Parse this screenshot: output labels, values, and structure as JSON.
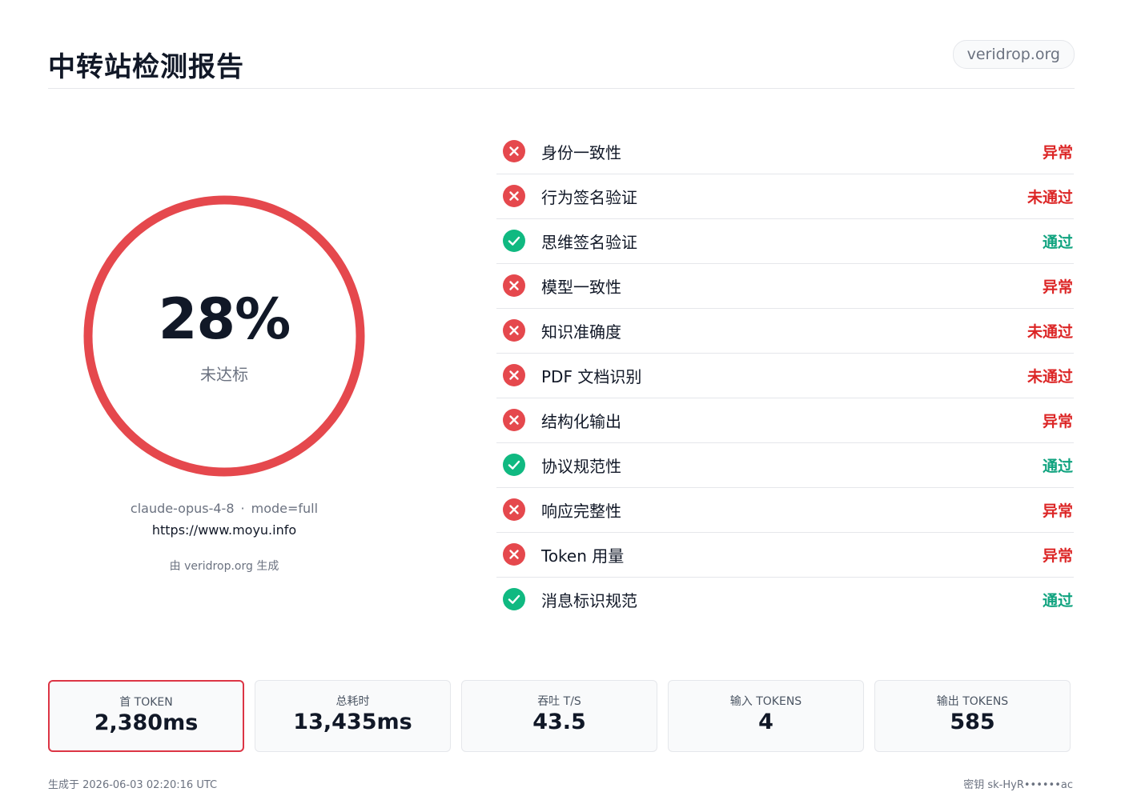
{
  "header": {
    "title": "中转站检测报告",
    "site_badge": "veridrop.org"
  },
  "score": {
    "value": "28%",
    "percent": 28,
    "status": "未达标",
    "ring_color": "#e5484d"
  },
  "meta": {
    "model": "claude-opus-4-8",
    "separator": "·",
    "mode": "mode=full",
    "url": "https://www.moyu.info",
    "generated_by": "由 veridrop.org 生成"
  },
  "colors": {
    "fail": "#e5484d",
    "fail_text": "#dc2626",
    "pass": "#10b981",
    "pass_text": "#10a37f"
  },
  "checks": [
    {
      "label": "身份一致性",
      "status": "异常",
      "result": "fail",
      "icon": "x-circle-icon"
    },
    {
      "label": "行为签名验证",
      "status": "未通过",
      "result": "fail",
      "icon": "x-circle-icon"
    },
    {
      "label": "思维签名验证",
      "status": "通过",
      "result": "pass",
      "icon": "check-circle-icon"
    },
    {
      "label": "模型一致性",
      "status": "异常",
      "result": "fail",
      "icon": "x-circle-icon"
    },
    {
      "label": "知识准确度",
      "status": "未通过",
      "result": "fail",
      "icon": "x-circle-icon"
    },
    {
      "label": "PDF 文档识别",
      "status": "未通过",
      "result": "fail",
      "icon": "x-circle-icon"
    },
    {
      "label": "结构化输出",
      "status": "异常",
      "result": "fail",
      "icon": "x-circle-icon"
    },
    {
      "label": "协议规范性",
      "status": "通过",
      "result": "pass",
      "icon": "check-circle-icon"
    },
    {
      "label": "响应完整性",
      "status": "异常",
      "result": "fail",
      "icon": "x-circle-icon"
    },
    {
      "label": "Token 用量",
      "status": "异常",
      "result": "fail",
      "icon": "x-circle-icon"
    },
    {
      "label": "消息标识规范",
      "status": "通过",
      "result": "pass",
      "icon": "check-circle-icon"
    }
  ],
  "stats": [
    {
      "label": "首 TOKEN",
      "value": "2,380ms",
      "highlight": true
    },
    {
      "label": "总耗时",
      "value": "13,435ms",
      "highlight": false
    },
    {
      "label": "吞吐 T/S",
      "value": "43.5",
      "highlight": false
    },
    {
      "label": "输入 TOKENS",
      "value": "4",
      "highlight": false
    },
    {
      "label": "输出 TOKENS",
      "value": "585",
      "highlight": false
    }
  ],
  "footer": {
    "generated_at": "生成于 2026-06-03 02:20:16 UTC",
    "key": "密钥 sk-HyR••••••ac"
  }
}
